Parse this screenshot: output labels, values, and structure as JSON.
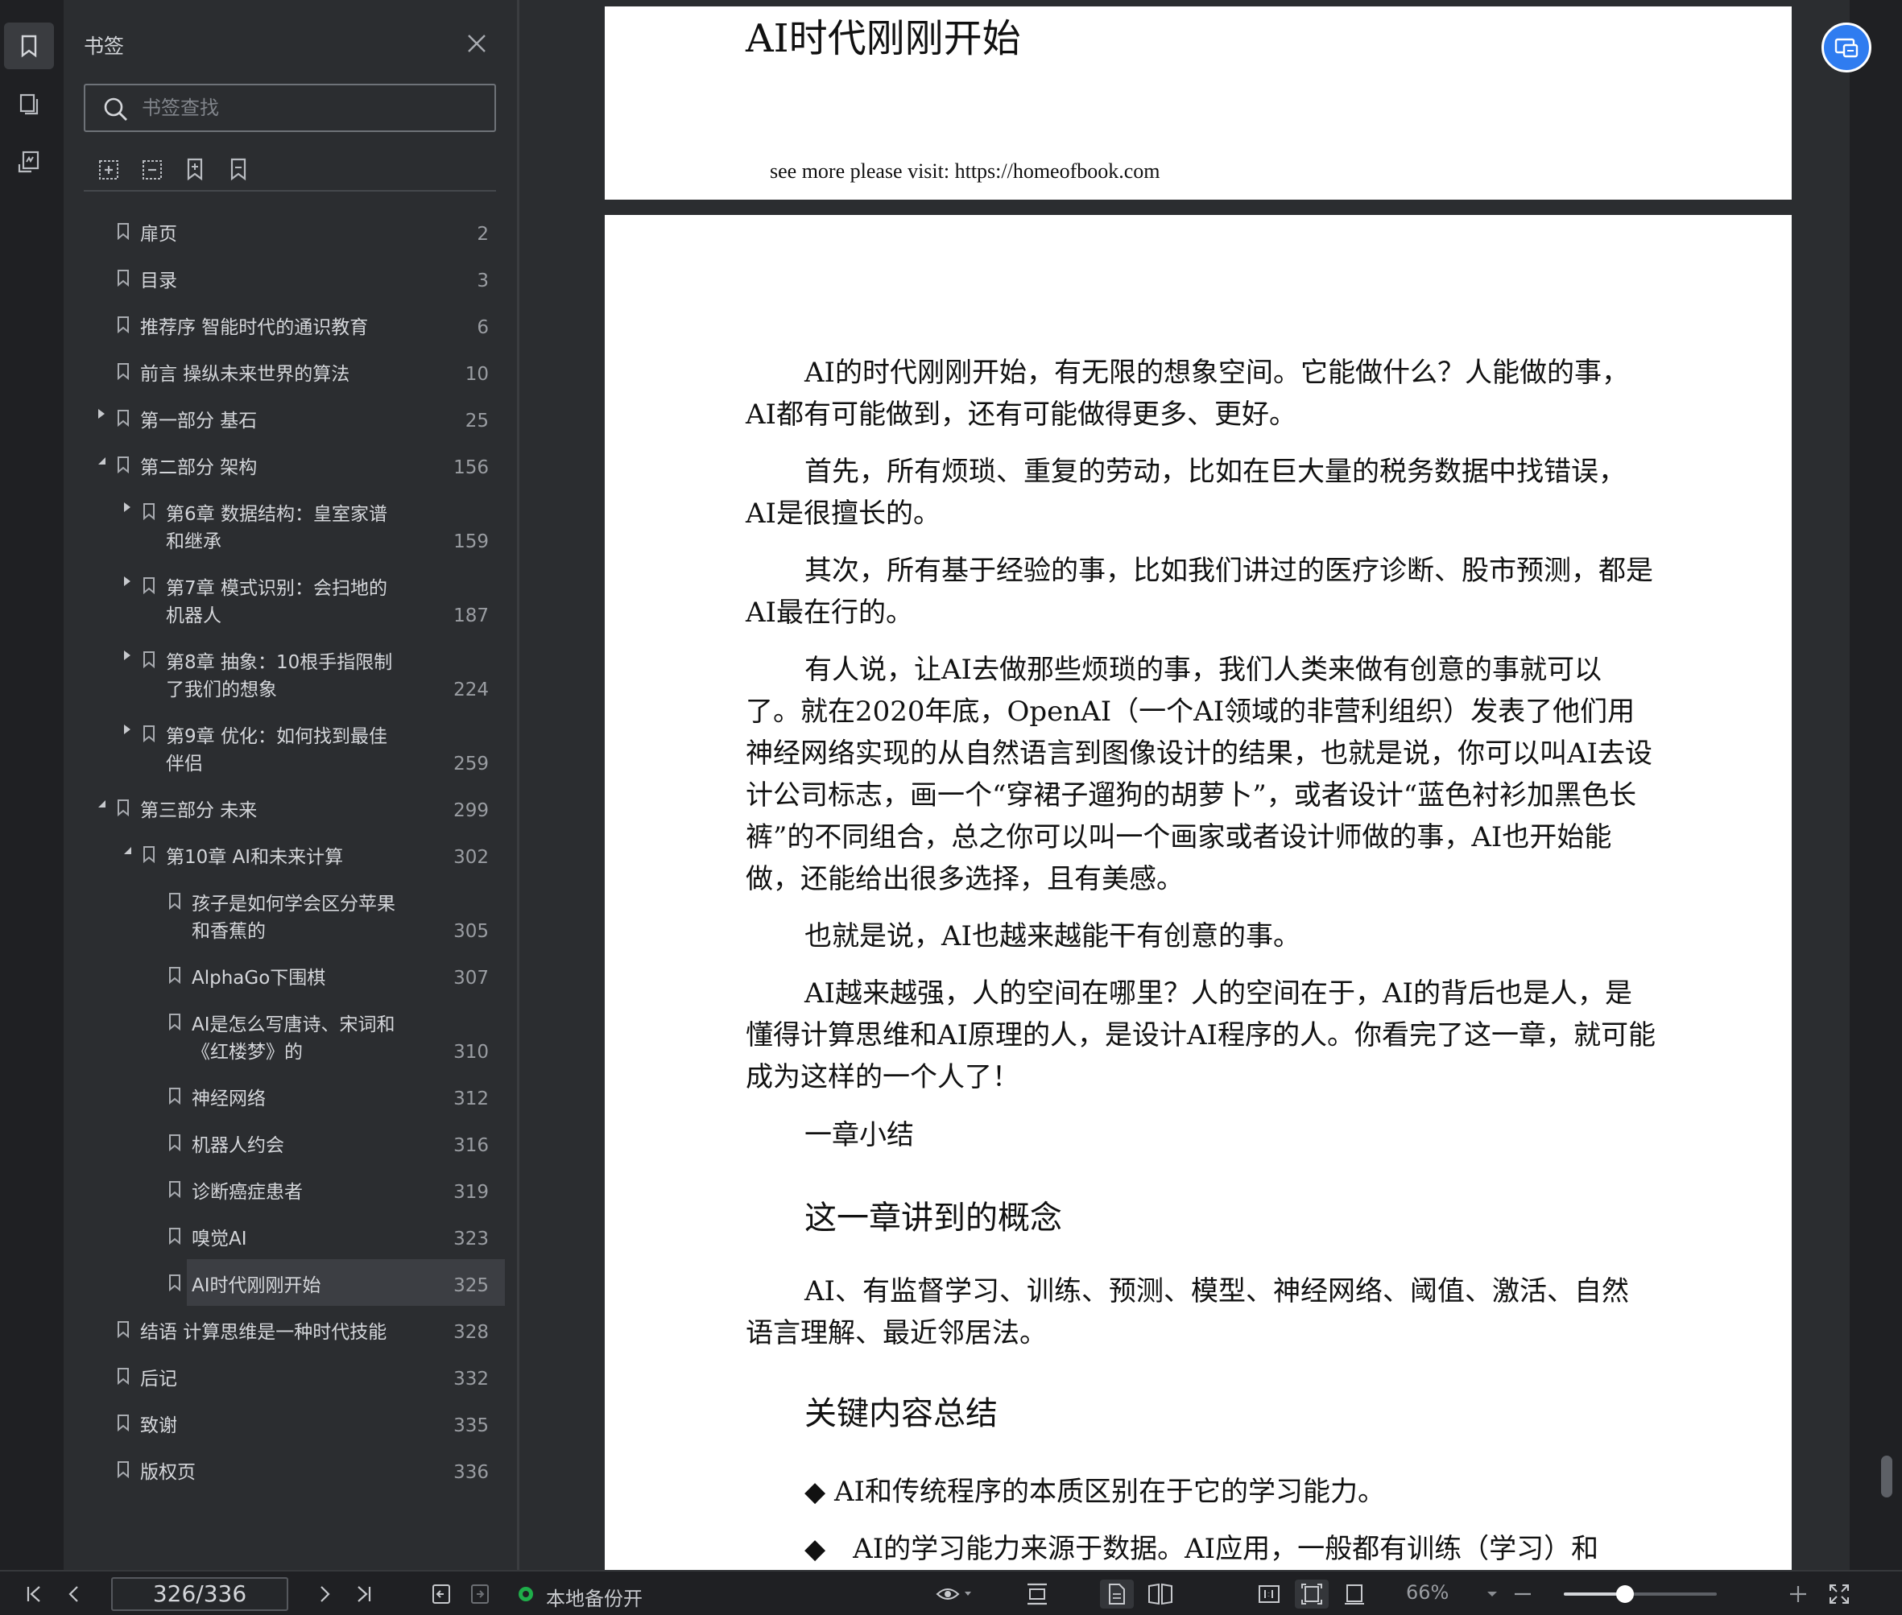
{
  "panel": {
    "title": "书签",
    "search_placeholder": "书签查找"
  },
  "bookmarks": [
    {
      "label": "扉页",
      "page": "2"
    },
    {
      "label": "目录",
      "page": "3"
    },
    {
      "label": "推荐序 智能时代的通识教育",
      "page": "6"
    },
    {
      "label": "前言 操纵未来世界的算法",
      "page": "10"
    },
    {
      "label": "第一部分 基石",
      "page": "25"
    },
    {
      "label": "第二部分 架构",
      "page": "156"
    },
    {
      "label": "第6章 数据结构：皇室家谱\n和继承",
      "page": "159"
    },
    {
      "label": "第7章 模式识别：会扫地的\n机器人",
      "page": "187"
    },
    {
      "label": "第8章 抽象：10根手指限制\n了我们的想象",
      "page": "224"
    },
    {
      "label": "第9章 优化：如何找到最佳\n伴侣",
      "page": "259"
    },
    {
      "label": "第三部分 未来",
      "page": "299"
    },
    {
      "label": "第10章 AI和未来计算",
      "page": "302"
    },
    {
      "label": "孩子是如何学会区分苹果\n和香蕉的",
      "page": "305"
    },
    {
      "label": "AlphaGo下围棋",
      "page": "307"
    },
    {
      "label": "AI是怎么写唐诗、宋词和\n《红楼梦》的",
      "page": "310"
    },
    {
      "label": "神经网络",
      "page": "312"
    },
    {
      "label": "机器人约会",
      "page": "316"
    },
    {
      "label": "诊断癌症患者",
      "page": "319"
    },
    {
      "label": "嗅觉AI",
      "page": "323"
    },
    {
      "label": "AI时代刚刚开始",
      "page": "325"
    },
    {
      "label": "结语 计算思维是一种时代技能",
      "page": "328"
    },
    {
      "label": "后记",
      "page": "332"
    },
    {
      "label": "致谢",
      "page": "335"
    },
    {
      "label": "版权页",
      "page": "336"
    }
  ],
  "document": {
    "top_title": "AI时代刚刚开始",
    "visit_text": "see more please visit: https://homeofbook.com",
    "paragraphs": [
      "AI的时代刚刚开始，有无限的想象空间。它能做什么？人能做的事，AI都有可能做到，还有可能做得更多、更好。",
      "首先，所有烦琐、重复的劳动，比如在巨大量的税务数据中找错误，AI是很擅长的。",
      "其次，所有基于经验的事，比如我们讲过的医疗诊断、股市预测，都是AI最在行的。",
      "有人说，让AI去做那些烦琐的事，我们人类来做有创意的事就可以了。就在2020年底，OpenAI（一个AI领域的非营利组织）发表了他们用神经网络实现的从自然语言到图像设计的结果，也就是说，你可以叫AI去设计公司标志，画一个“穿裙子遛狗的胡萝卜”，或者设计“蓝色衬衫加黑色长裤”的不同组合，总之你可以叫一个画家或者设计师做的事，AI也开始能做，还能给出很多选择，且有美感。",
      "也就是说，AI也越来越能干有创意的事。",
      "AI越来越强，人的空间在哪里？人的空间在于，AI的背后也是人，是懂得计算思维和AI原理的人，是设计AI程序的人。你看完了这一章，就可能成为这样的一个人了！",
      "一章小结"
    ],
    "heading_concepts": "这一章讲到的概念",
    "concepts_text": "AI、有监督学习、训练、预测、模型、神经网络、阈值、激活、自然语言理解、最近邻居法。",
    "heading_summary": "关键内容总结",
    "bullet_1": "◆ AI和传统程序的本质区别在于它的学习能力。",
    "bullet_2": "◆　AI的学习能力来源于数据。AI应用，一般都有训练（学习）和"
  },
  "status": {
    "page_indicator": "326/336",
    "backup_text": "本地备份开",
    "zoom": "66%",
    "zoom_fraction": 0.4
  },
  "colors": {
    "accent": "#2f7cf0",
    "backup_dot": "#1fae4a"
  }
}
